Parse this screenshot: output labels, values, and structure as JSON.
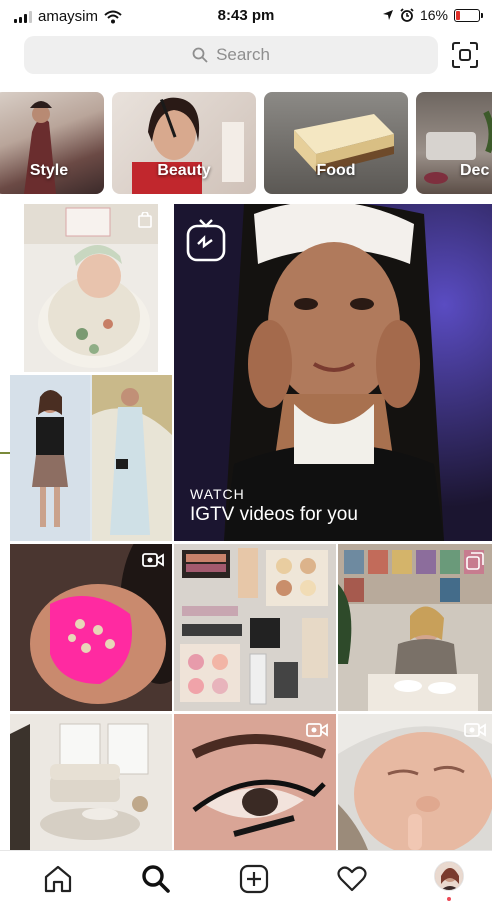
{
  "status_bar": {
    "carrier": "amaysim",
    "time": "8:43 pm",
    "battery": "16%",
    "battery_level": 0.16
  },
  "search": {
    "placeholder": "Search",
    "icon": "search-icon",
    "scan_icon": "scan-icon"
  },
  "categories": [
    {
      "label": "Style"
    },
    {
      "label": "Beauty"
    },
    {
      "label": "Food"
    },
    {
      "label": "Dec"
    }
  ],
  "igtv": {
    "eyebrow": "WATCH",
    "title": "IGTV videos for you",
    "icon": "igtv-icon"
  },
  "bottom_nav": {
    "items": [
      "home-icon",
      "search-icon",
      "new-post-icon",
      "activity-heart-icon",
      "profile-avatar"
    ]
  },
  "colors": {
    "battery_low": "#e0312b",
    "notification_dot": "#ed4956",
    "search_bg": "#efefef"
  }
}
